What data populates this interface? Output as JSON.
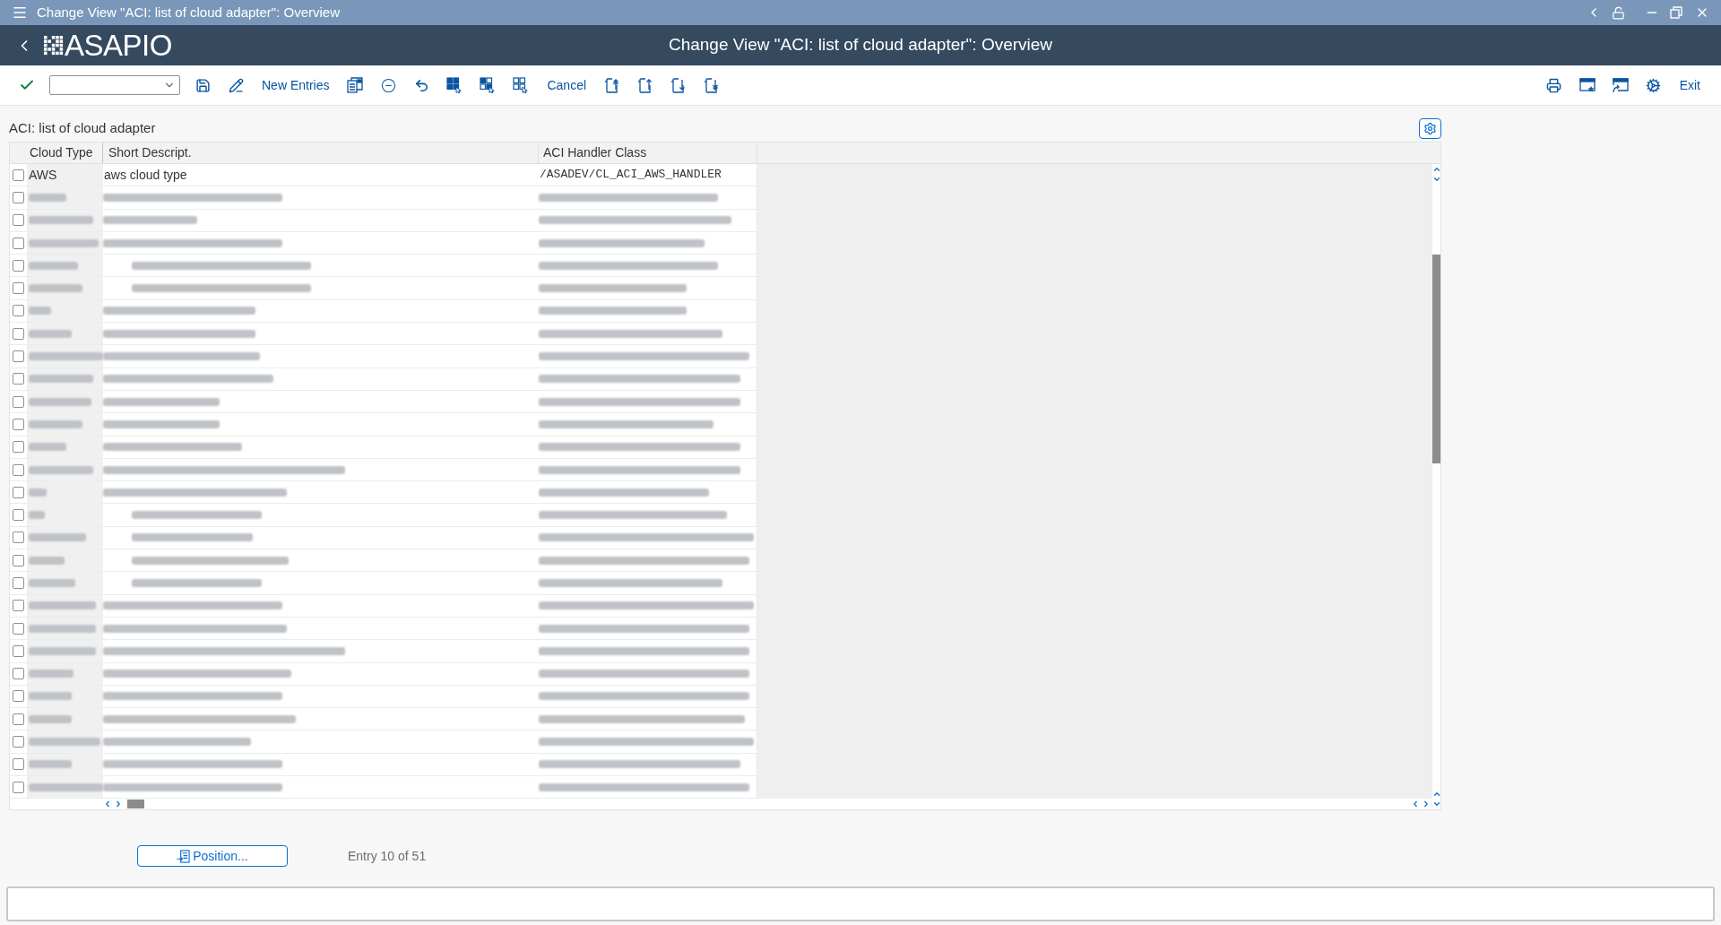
{
  "window": {
    "title": "Change View \"ACI: list of cloud adapter\": Overview"
  },
  "header": {
    "logo": "ASAPIO",
    "title": "Change View \"ACI: list of cloud adapter\": Overview"
  },
  "toolbar": {
    "new_entries": "New Entries",
    "cancel": "Cancel",
    "exit": "Exit"
  },
  "table": {
    "title": "ACI: list of cloud adapter",
    "columns": [
      "Cloud Type",
      "Short Descript.",
      "ACI Handler Class"
    ],
    "rows": [
      {
        "checked": false,
        "blurred": false,
        "cells": [
          "AWS",
          "aws cloud type",
          "/ASADEV/CL_ACI_AWS_HANDLER"
        ]
      },
      {
        "checked": false,
        "blurred": true
      },
      {
        "checked": false,
        "blurred": true
      },
      {
        "checked": false,
        "blurred": true
      },
      {
        "checked": false,
        "blurred": true
      },
      {
        "checked": false,
        "blurred": true
      },
      {
        "checked": false,
        "blurred": true
      },
      {
        "checked": false,
        "blurred": true
      },
      {
        "checked": false,
        "blurred": true
      },
      {
        "checked": false,
        "blurred": true
      },
      {
        "checked": false,
        "blurred": true
      },
      {
        "checked": false,
        "blurred": true
      },
      {
        "checked": false,
        "blurred": true
      },
      {
        "checked": false,
        "blurred": true
      },
      {
        "checked": false,
        "blurred": true
      },
      {
        "checked": false,
        "blurred": true
      },
      {
        "checked": false,
        "blurred": true
      },
      {
        "checked": false,
        "blurred": true
      },
      {
        "checked": false,
        "blurred": true
      },
      {
        "checked": false,
        "blurred": true
      },
      {
        "checked": false,
        "blurred": true
      },
      {
        "checked": false,
        "blurred": true
      },
      {
        "checked": false,
        "blurred": true
      },
      {
        "checked": false,
        "blurred": true
      },
      {
        "checked": false,
        "blurred": true
      },
      {
        "checked": false,
        "blurred": true
      },
      {
        "checked": false,
        "blurred": true
      },
      {
        "checked": false,
        "blurred": true
      }
    ]
  },
  "footer": {
    "position_button": "Position...",
    "entry_info": "Entry 10 of 51"
  }
}
